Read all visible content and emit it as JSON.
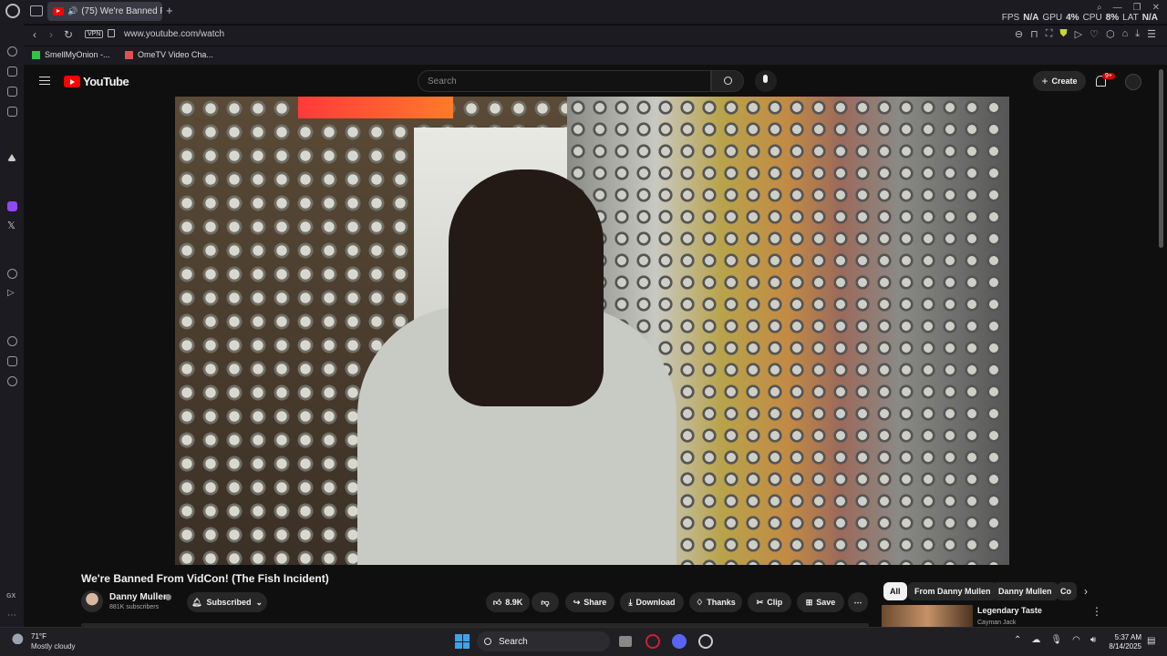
{
  "browser": {
    "tab_title": "(75) We're Banned Fr...",
    "new_tab": "+",
    "url": "www.youtube.com/watch",
    "vpn_label": "VPN",
    "perf": {
      "fps_label": "FPS",
      "fps_value": "N/A",
      "gpu_label": "GPU",
      "gpu_value": "4%",
      "cpu_label": "CPU",
      "cpu_value": "8%",
      "lat_label": "LAT",
      "lat_value": "N/A"
    },
    "bookmarks": [
      {
        "label": "SmellMyOnion -...",
        "color": "#22cc44"
      },
      {
        "label": "OmeTV Video Cha...",
        "color": "#e05050"
      }
    ]
  },
  "youtube": {
    "logo_text": "YouTube",
    "search_placeholder": "Search",
    "create_label": "Create",
    "notification_count": "9+",
    "video": {
      "title": "We're Banned From VidCon! (The Fish Incident)",
      "channel_name": "Danny Mullen",
      "subscribers": "881K subscribers",
      "subscribe_state": "Subscribed",
      "likes": "8.9K",
      "actions": [
        "Share",
        "Download",
        "Thanks",
        "Clip",
        "Save"
      ],
      "more": "⋯"
    },
    "chips": [
      "All",
      "From Danny Mullen",
      "Danny Mullen",
      "Co"
    ],
    "recommendation": {
      "title": "Legendary Taste",
      "channel": "Cayman Jack"
    }
  },
  "taskbar": {
    "weather_temp": "71°F",
    "weather_desc": "Mostly cloudy",
    "search_label": "Search",
    "time": "5:37 AM",
    "date": "8/14/2025"
  },
  "colors": {
    "youtube_red": "#ff0000",
    "background": "#0f0f0f",
    "accent_blue": "#3aa3f0"
  }
}
